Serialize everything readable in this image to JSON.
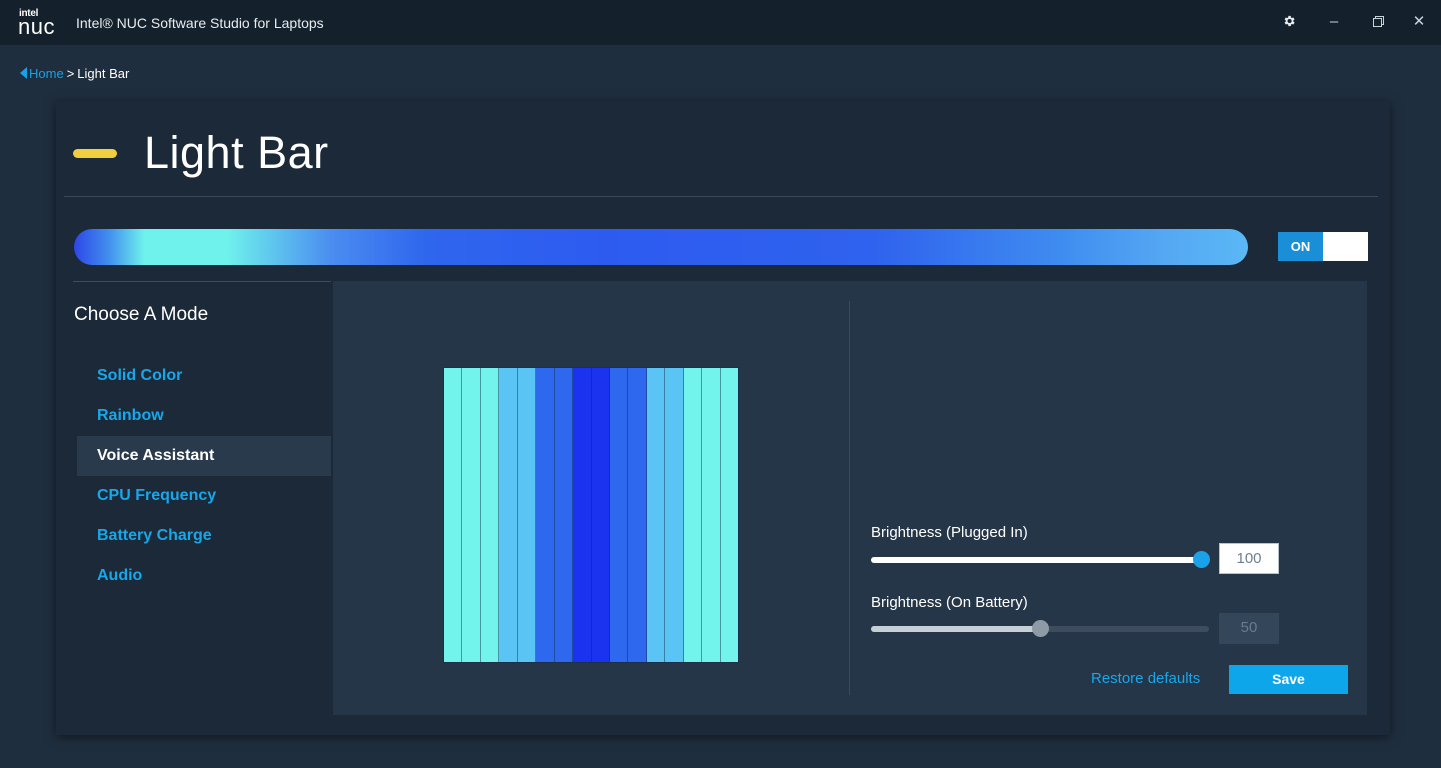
{
  "window": {
    "logo_small": "intel",
    "logo_big": "nuc",
    "title": "Intel® NUC Software Studio for Laptops"
  },
  "breadcrumb": {
    "home": "Home",
    "separator": ">",
    "current": "Light Bar"
  },
  "page": {
    "title": "Light Bar",
    "title_accent_color": "#f1cd40"
  },
  "toggle": {
    "label": "ON",
    "state": "on"
  },
  "modes": {
    "heading": "Choose A Mode",
    "items": [
      {
        "label": "Solid Color",
        "active": false
      },
      {
        "label": "Rainbow",
        "active": false
      },
      {
        "label": "Voice Assistant",
        "active": true
      },
      {
        "label": "CPU Frequency",
        "active": false
      },
      {
        "label": "Battery Charge",
        "active": false
      },
      {
        "label": "Audio",
        "active": false
      }
    ]
  },
  "preview": {
    "column_colors": [
      "#72f4ec",
      "#72f4ec",
      "#72f4ec",
      "#5ac4f5",
      "#5ac4f5",
      "#2d68ef",
      "#2d68ef",
      "#1b33ef",
      "#1b33ef",
      "#2d68ef",
      "#2d68ef",
      "#5ac4f5",
      "#5ac4f5",
      "#72f4ec",
      "#72f4ec",
      "#72f4ec"
    ]
  },
  "brightness_plugged": {
    "label": "Brightness (Plugged In)",
    "value": "100",
    "level": 1.0,
    "enabled": true
  },
  "brightness_battery": {
    "label": "Brightness (On Battery)",
    "value": "50",
    "level": 0.5,
    "enabled": false
  },
  "actions": {
    "restore": "Restore defaults",
    "save": "Save"
  },
  "colors": {
    "accent": "#18a7ea",
    "background": "#1f2e3e",
    "panel": "#253648"
  }
}
